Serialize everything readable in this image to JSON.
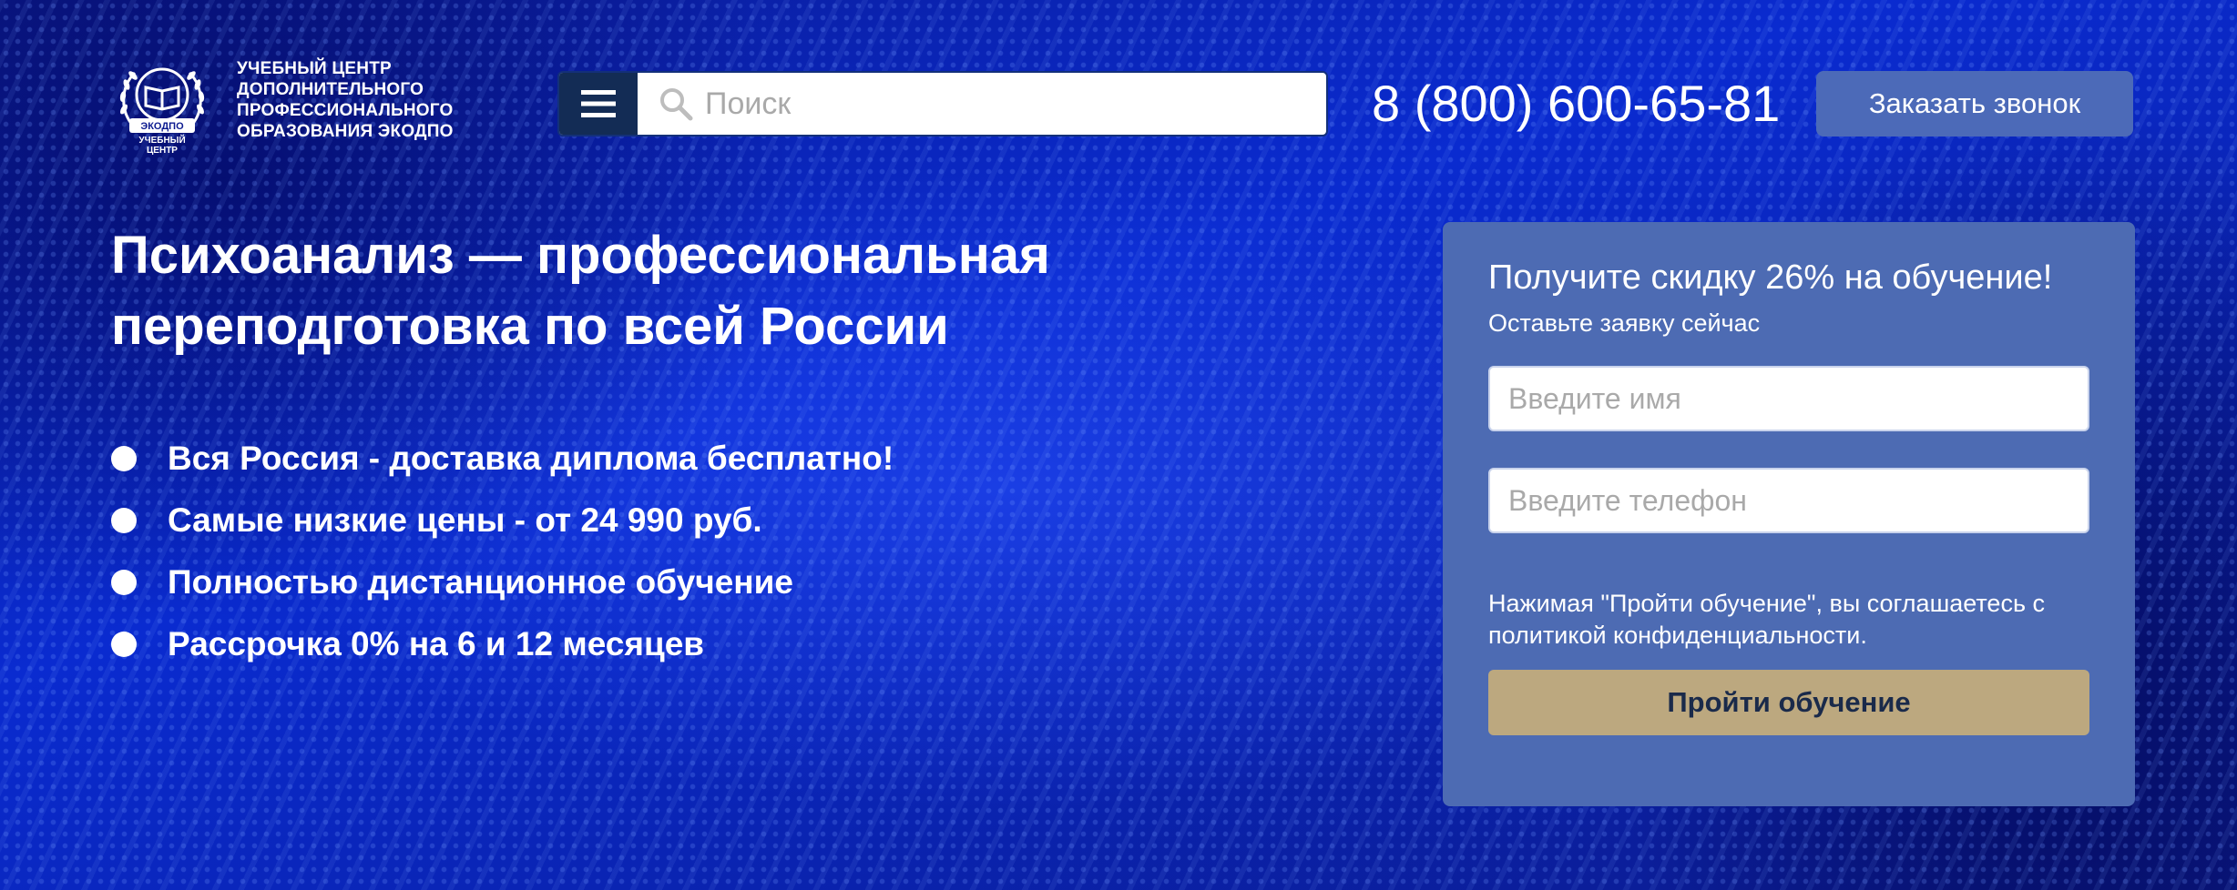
{
  "header": {
    "logo": {
      "icon": "book-laurel-emblem-icon",
      "ribbon_text": "ЭКОДПО",
      "under_text_1": "УЧЕБНЫЙ",
      "under_text_2": "ЦЕНТР"
    },
    "org_name_lines": [
      "УЧЕБНЫЙ ЦЕНТР",
      "ДОПОЛНИТЕЛЬНОГО",
      "ПРОФЕССИОНАЛЬНОГО",
      "ОБРАЗОВАНИЯ ЭКОДПО"
    ],
    "menu_icon": "hamburger-menu-icon",
    "search": {
      "icon": "search-icon",
      "placeholder": "Поиск",
      "value": ""
    },
    "phone": "8 (800) 600-65-81",
    "callback_button": "Заказать звонок"
  },
  "hero": {
    "title": "Психоанализ — профессиональная переподготовка по всей России",
    "features": [
      "Вся Россия - доставка диплома бесплатно!",
      "Самые низкие цены - от 24 990 руб.",
      "Полностью дистанционное обучение",
      "Рассрочка 0% на 6 и 12 месяцев"
    ]
  },
  "form": {
    "title": "Получите скидку 26% на обучение!",
    "subtitle": "Оставьте заявку сейчас",
    "name_placeholder": "Введите имя",
    "name_value": "",
    "phone_placeholder": "Введите телефон",
    "phone_value": "",
    "consent": "Нажимая \"Пройти обучение\", вы соглашаетесь с политикой конфиденциальности.",
    "submit": "Пройти обучение"
  },
  "colors": {
    "background": "#0a1fa8",
    "menu_button": "#132c55",
    "callback_button": "#4c6ab8",
    "form_panel": "#4d6bb3",
    "submit_button": "#bca87f"
  }
}
